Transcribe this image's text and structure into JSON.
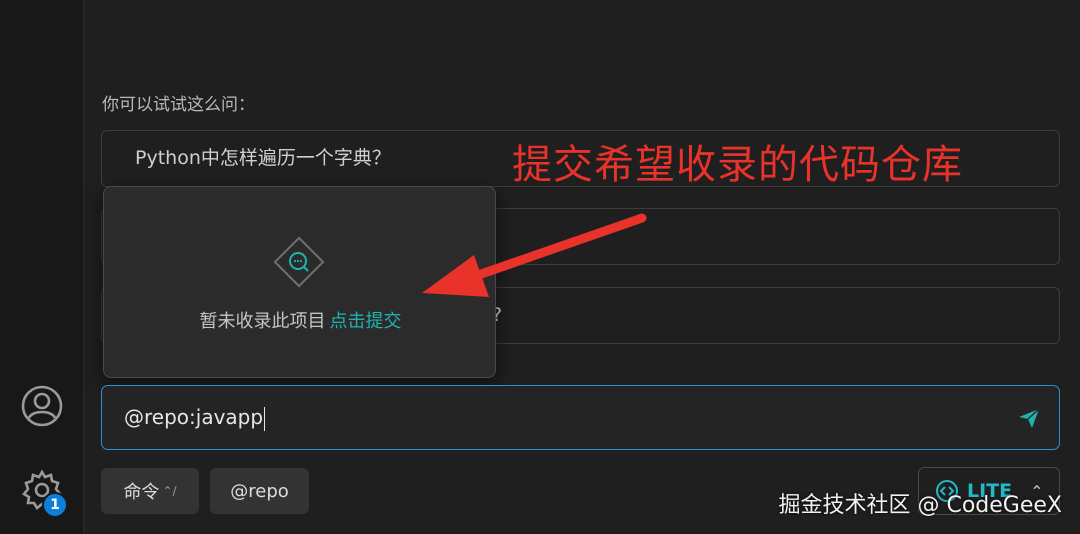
{
  "hint_label": "你可以试试这么问：",
  "suggestions": [
    {
      "text": "Python中怎样遍历一个字典？"
    },
    {
      "text": ""
    },
    {
      "text": "?"
    }
  ],
  "annotation": "提交希望收录的代码仓库",
  "popup": {
    "message": "暂未收录此项目",
    "link": "点击提交",
    "icon": "search-chat-icon"
  },
  "input": {
    "value": "@repo:javapp"
  },
  "toolbar": {
    "command_label": "命令",
    "command_shortcut": "⌃/",
    "repo_label": "@repo",
    "lite_label": "LITE"
  },
  "activity": {
    "badge_count": "1"
  },
  "watermark": "掘金技术社区 @ CodeGeeX",
  "colors": {
    "accent": "#1fb3b0",
    "focus_border": "#2f8fd3",
    "annotation": "#e8322a",
    "badge": "#0d7fd8"
  }
}
